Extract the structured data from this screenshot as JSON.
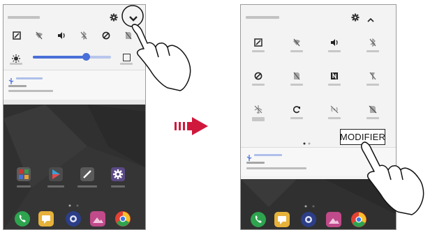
{
  "modifier_label": "MODIFIER",
  "colors": {
    "accent": "#4a6fd8",
    "slider_track": "#b9c6ec",
    "arrow": "#d0183c",
    "wallpaper": "#303030",
    "frame": "#9a9a9a"
  },
  "brightness_slider_level": 0.68,
  "left_phone": {
    "quick_settings_icons": [
      "nfc-icon",
      "wifi-off-icon",
      "sound-icon",
      "bluetooth-off-icon",
      "do-not-disturb-icon",
      "sim-icon"
    ],
    "controls": [
      "settings-icon",
      "expand-chevron-icon"
    ],
    "home_apps": [
      "folder-icon",
      "play-store-icon",
      "pen-icon",
      "settings-app-icon"
    ],
    "dock_apps": [
      "phone-icon",
      "messages-icon",
      "camera-icon",
      "gallery-icon",
      "chrome-icon"
    ]
  },
  "right_phone": {
    "quick_settings_rows": [
      [
        "nfc-icon",
        "wifi-off-icon",
        "sound-icon",
        "bluetooth-off-icon"
      ],
      [
        "do-not-disturb-icon",
        "sim-icon",
        "nfc-n-icon",
        "flashlight-icon"
      ],
      [
        "airplane-icon",
        "rotate-icon",
        "hotspot-icon",
        "sim-off-icon"
      ]
    ],
    "controls": [
      "settings-icon",
      "collapse-chevron-icon"
    ],
    "dock_apps": [
      "phone-icon",
      "messages-icon",
      "camera-icon",
      "gallery-icon",
      "chrome-icon"
    ]
  }
}
